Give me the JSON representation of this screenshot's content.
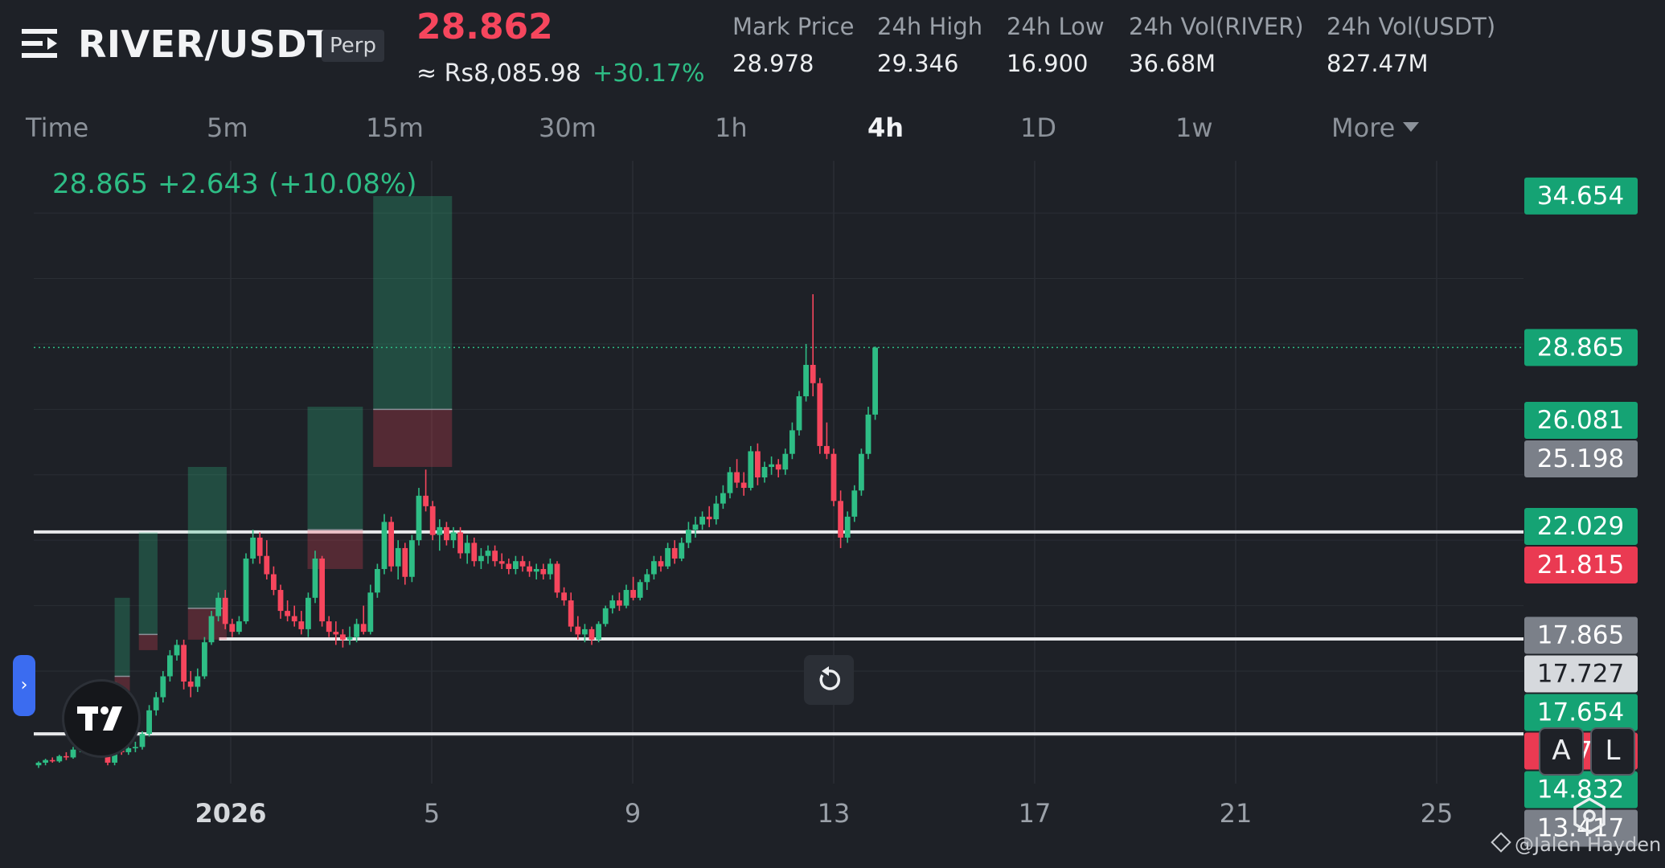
{
  "header": {
    "pair": "RIVER/USDT",
    "contract_type": "Perp",
    "last_price": "28.862",
    "fiat_price": "≈ Rs8,085.98",
    "change_pct": "+30.17%",
    "stats": [
      {
        "label": "Mark Price",
        "value": "28.978"
      },
      {
        "label": "24h High",
        "value": "29.346"
      },
      {
        "label": "24h Low",
        "value": "16.900"
      },
      {
        "label": "24h Vol(RIVER)",
        "value": "36.68M"
      },
      {
        "label": "24h Vol(USDT)",
        "value": "827.47M"
      }
    ]
  },
  "intervals": {
    "tabs": [
      "Time",
      "5m",
      "15m",
      "30m",
      "1h",
      "4h",
      "1D",
      "1w",
      "More"
    ],
    "active": "4h"
  },
  "readout": {
    "close": "28.865",
    "change": "+2.643",
    "change_pct": "(+10.08%)"
  },
  "controls": {
    "scale_auto": "A",
    "scale_log": "L",
    "sidebar_arrow": "›"
  },
  "watermark": "@Jalen Hayden",
  "colors": {
    "up": "#2ebd85",
    "down": "#f6465d",
    "gray_label": "#8a8f98",
    "light_label": "#d5d8dc",
    "background": "#1e2127"
  },
  "chart_data": {
    "type": "candlestick",
    "symbol": "RIVER/USDT",
    "interval": "4h",
    "x_tick_labels": [
      "2026",
      "5",
      "9",
      "13",
      "17",
      "21",
      "25"
    ],
    "ylim": [
      12.2,
      36.0
    ],
    "last_price": 28.865,
    "price_labels": [
      {
        "value": 34.654,
        "style": "up"
      },
      {
        "value": 28.865,
        "style": "up"
      },
      {
        "value": 26.081,
        "style": "up"
      },
      {
        "value": 25.198,
        "style": "gray"
      },
      {
        "value": 22.029,
        "style": "up"
      },
      {
        "value": 21.815,
        "style": "down"
      },
      {
        "value": 17.865,
        "style": "gray"
      },
      {
        "value": 17.727,
        "style": "light"
      },
      {
        "value": 17.654,
        "style": "up"
      },
      {
        "value": 15.716,
        "style": "down"
      },
      {
        "value": 14.832,
        "style": "up"
      },
      {
        "value": 13.417,
        "style": "gray"
      }
    ],
    "horizontal_lines": [
      {
        "value": 21.815,
        "from": 0.0
      },
      {
        "value": 17.727,
        "from": 7.5
      },
      {
        "value": 14.1,
        "from": 0.0
      }
    ],
    "positions": [
      {
        "x0": 7.8,
        "x1": 11.3,
        "entry": 14.4,
        "target": 16.1,
        "stop": 13.75
      },
      {
        "x0": 11.0,
        "x1": 13.2,
        "entry": 16.3,
        "target": 19.3,
        "stop": 15.6
      },
      {
        "x0": 14.5,
        "x1": 17.2,
        "entry": 17.9,
        "target": 21.8,
        "stop": 17.3
      },
      {
        "x0": 21.6,
        "x1": 27.2,
        "entry": 18.9,
        "target": 24.3,
        "stop": 17.7
      },
      {
        "x0": 38.9,
        "x1": 46.9,
        "entry": 21.9,
        "target": 26.6,
        "stop": 20.4
      },
      {
        "x0": 48.4,
        "x1": 59.8,
        "entry": 26.5,
        "target": 34.65,
        "stop": 24.3
      }
    ],
    "candles": [
      {
        "o": 12.9,
        "h": 13.05,
        "l": 12.8,
        "c": 13.0
      },
      {
        "o": 13.0,
        "h": 13.15,
        "l": 12.9,
        "c": 13.1
      },
      {
        "o": 13.1,
        "h": 13.2,
        "l": 13.0,
        "c": 13.05
      },
      {
        "o": 13.05,
        "h": 13.3,
        "l": 13.0,
        "c": 13.25
      },
      {
        "o": 13.25,
        "h": 13.4,
        "l": 13.1,
        "c": 13.2
      },
      {
        "o": 13.2,
        "h": 13.6,
        "l": 13.15,
        "c": 13.5
      },
      {
        "o": 13.5,
        "h": 13.9,
        "l": 13.4,
        "c": 13.8
      },
      {
        "o": 13.8,
        "h": 14.0,
        "l": 13.6,
        "c": 13.7
      },
      {
        "o": 13.7,
        "h": 13.8,
        "l": 13.4,
        "c": 13.5
      },
      {
        "o": 13.5,
        "h": 13.7,
        "l": 13.3,
        "c": 13.4
      },
      {
        "o": 13.4,
        "h": 13.5,
        "l": 12.9,
        "c": 13.0
      },
      {
        "o": 13.0,
        "h": 13.6,
        "l": 12.9,
        "c": 13.5
      },
      {
        "o": 13.5,
        "h": 13.6,
        "l": 13.3,
        "c": 13.4
      },
      {
        "o": 13.4,
        "h": 13.6,
        "l": 13.3,
        "c": 13.55
      },
      {
        "o": 13.55,
        "h": 13.8,
        "l": 13.4,
        "c": 13.6
      },
      {
        "o": 13.6,
        "h": 14.2,
        "l": 13.5,
        "c": 14.1
      },
      {
        "o": 14.1,
        "h": 15.2,
        "l": 14.0,
        "c": 15.0
      },
      {
        "o": 15.0,
        "h": 15.7,
        "l": 14.8,
        "c": 15.5
      },
      {
        "o": 15.5,
        "h": 16.5,
        "l": 15.3,
        "c": 16.3
      },
      {
        "o": 16.3,
        "h": 17.3,
        "l": 16.1,
        "c": 17.1
      },
      {
        "o": 17.1,
        "h": 17.7,
        "l": 16.9,
        "c": 17.5
      },
      {
        "o": 17.5,
        "h": 17.7,
        "l": 15.8,
        "c": 16.1
      },
      {
        "o": 16.1,
        "h": 16.5,
        "l": 15.5,
        "c": 15.9
      },
      {
        "o": 15.9,
        "h": 16.6,
        "l": 15.7,
        "c": 16.3
      },
      {
        "o": 16.3,
        "h": 17.8,
        "l": 16.2,
        "c": 17.6
      },
      {
        "o": 17.6,
        "h": 18.8,
        "l": 17.5,
        "c": 18.6
      },
      {
        "o": 18.6,
        "h": 19.5,
        "l": 18.4,
        "c": 19.3
      },
      {
        "o": 19.3,
        "h": 19.6,
        "l": 18.1,
        "c": 18.3
      },
      {
        "o": 18.3,
        "h": 18.5,
        "l": 17.8,
        "c": 18.0
      },
      {
        "o": 18.0,
        "h": 18.6,
        "l": 17.9,
        "c": 18.4
      },
      {
        "o": 18.4,
        "h": 21.0,
        "l": 18.3,
        "c": 20.8
      },
      {
        "o": 20.8,
        "h": 21.9,
        "l": 20.6,
        "c": 21.6
      },
      {
        "o": 21.6,
        "h": 21.8,
        "l": 20.6,
        "c": 20.9
      },
      {
        "o": 20.9,
        "h": 21.5,
        "l": 20.0,
        "c": 20.2
      },
      {
        "o": 20.2,
        "h": 20.5,
        "l": 19.4,
        "c": 19.6
      },
      {
        "o": 19.6,
        "h": 19.8,
        "l": 18.5,
        "c": 18.8
      },
      {
        "o": 18.8,
        "h": 19.2,
        "l": 18.4,
        "c": 18.6
      },
      {
        "o": 18.6,
        "h": 19.0,
        "l": 18.2,
        "c": 18.4
      },
      {
        "o": 18.4,
        "h": 18.8,
        "l": 17.9,
        "c": 18.1
      },
      {
        "o": 18.1,
        "h": 19.5,
        "l": 17.8,
        "c": 19.3
      },
      {
        "o": 19.3,
        "h": 21.1,
        "l": 19.1,
        "c": 20.8
      },
      {
        "o": 20.8,
        "h": 20.9,
        "l": 18.2,
        "c": 18.4
      },
      {
        "o": 18.4,
        "h": 18.6,
        "l": 17.8,
        "c": 18.0
      },
      {
        "o": 18.0,
        "h": 18.4,
        "l": 17.5,
        "c": 17.9
      },
      {
        "o": 17.9,
        "h": 18.1,
        "l": 17.4,
        "c": 17.7
      },
      {
        "o": 17.7,
        "h": 18.2,
        "l": 17.5,
        "c": 17.8
      },
      {
        "o": 17.8,
        "h": 18.5,
        "l": 17.6,
        "c": 18.3
      },
      {
        "o": 18.3,
        "h": 19.0,
        "l": 17.9,
        "c": 18.0
      },
      {
        "o": 18.0,
        "h": 19.8,
        "l": 17.9,
        "c": 19.5
      },
      {
        "o": 19.5,
        "h": 20.6,
        "l": 19.3,
        "c": 20.4
      },
      {
        "o": 20.4,
        "h": 22.5,
        "l": 20.2,
        "c": 22.2
      },
      {
        "o": 22.2,
        "h": 22.4,
        "l": 20.3,
        "c": 20.5
      },
      {
        "o": 20.5,
        "h": 21.5,
        "l": 20.0,
        "c": 21.2
      },
      {
        "o": 21.2,
        "h": 21.4,
        "l": 19.8,
        "c": 20.1
      },
      {
        "o": 20.1,
        "h": 21.7,
        "l": 19.9,
        "c": 21.5
      },
      {
        "o": 21.5,
        "h": 23.5,
        "l": 21.3,
        "c": 23.2
      },
      {
        "o": 23.2,
        "h": 24.2,
        "l": 22.6,
        "c": 22.8
      },
      {
        "o": 22.8,
        "h": 23.0,
        "l": 21.5,
        "c": 21.7
      },
      {
        "o": 21.7,
        "h": 22.3,
        "l": 21.1,
        "c": 22.0
      },
      {
        "o": 22.0,
        "h": 22.2,
        "l": 21.3,
        "c": 21.5
      },
      {
        "o": 21.5,
        "h": 22.0,
        "l": 21.2,
        "c": 21.8
      },
      {
        "o": 21.8,
        "h": 22.0,
        "l": 20.8,
        "c": 21.0
      },
      {
        "o": 21.0,
        "h": 21.7,
        "l": 20.6,
        "c": 21.4
      },
      {
        "o": 21.4,
        "h": 21.6,
        "l": 20.5,
        "c": 20.7
      },
      {
        "o": 20.7,
        "h": 21.2,
        "l": 20.4,
        "c": 20.9
      },
      {
        "o": 20.9,
        "h": 21.3,
        "l": 20.6,
        "c": 21.1
      },
      {
        "o": 21.1,
        "h": 21.3,
        "l": 20.5,
        "c": 20.7
      },
      {
        "o": 20.7,
        "h": 21.0,
        "l": 20.4,
        "c": 20.6
      },
      {
        "o": 20.6,
        "h": 20.8,
        "l": 20.2,
        "c": 20.4
      },
      {
        "o": 20.4,
        "h": 20.9,
        "l": 20.2,
        "c": 20.7
      },
      {
        "o": 20.7,
        "h": 20.9,
        "l": 20.3,
        "c": 20.5
      },
      {
        "o": 20.5,
        "h": 20.7,
        "l": 20.1,
        "c": 20.3
      },
      {
        "o": 20.3,
        "h": 20.6,
        "l": 20.0,
        "c": 20.4
      },
      {
        "o": 20.4,
        "h": 20.6,
        "l": 20.0,
        "c": 20.2
      },
      {
        "o": 20.2,
        "h": 20.8,
        "l": 20.0,
        "c": 20.6
      },
      {
        "o": 20.6,
        "h": 20.7,
        "l": 19.3,
        "c": 19.5
      },
      {
        "o": 19.5,
        "h": 19.7,
        "l": 19.0,
        "c": 19.2
      },
      {
        "o": 19.2,
        "h": 19.5,
        "l": 18.0,
        "c": 18.2
      },
      {
        "o": 18.2,
        "h": 18.6,
        "l": 17.7,
        "c": 17.9
      },
      {
        "o": 17.9,
        "h": 18.3,
        "l": 17.6,
        "c": 18.1
      },
      {
        "o": 18.1,
        "h": 18.2,
        "l": 17.5,
        "c": 17.7
      },
      {
        "o": 17.7,
        "h": 18.4,
        "l": 17.6,
        "c": 18.3
      },
      {
        "o": 18.3,
        "h": 19.0,
        "l": 18.2,
        "c": 18.9
      },
      {
        "o": 18.9,
        "h": 19.4,
        "l": 18.7,
        "c": 19.2
      },
      {
        "o": 19.2,
        "h": 19.5,
        "l": 18.8,
        "c": 19.0
      },
      {
        "o": 19.0,
        "h": 19.8,
        "l": 18.9,
        "c": 19.6
      },
      {
        "o": 19.6,
        "h": 20.1,
        "l": 19.2,
        "c": 19.3
      },
      {
        "o": 19.3,
        "h": 20.0,
        "l": 19.2,
        "c": 19.9
      },
      {
        "o": 19.9,
        "h": 20.4,
        "l": 19.6,
        "c": 20.2
      },
      {
        "o": 20.2,
        "h": 20.9,
        "l": 20.0,
        "c": 20.7
      },
      {
        "o": 20.7,
        "h": 20.9,
        "l": 20.3,
        "c": 20.5
      },
      {
        "o": 20.5,
        "h": 21.4,
        "l": 20.4,
        "c": 21.2
      },
      {
        "o": 21.2,
        "h": 21.5,
        "l": 20.6,
        "c": 20.8
      },
      {
        "o": 20.8,
        "h": 21.6,
        "l": 20.7,
        "c": 21.4
      },
      {
        "o": 21.4,
        "h": 22.2,
        "l": 21.2,
        "c": 21.9
      },
      {
        "o": 21.9,
        "h": 22.4,
        "l": 21.6,
        "c": 22.1
      },
      {
        "o": 22.1,
        "h": 22.6,
        "l": 21.9,
        "c": 22.4
      },
      {
        "o": 22.4,
        "h": 22.8,
        "l": 22.0,
        "c": 22.3
      },
      {
        "o": 22.3,
        "h": 23.2,
        "l": 22.1,
        "c": 22.9
      },
      {
        "o": 22.9,
        "h": 23.6,
        "l": 22.7,
        "c": 23.3
      },
      {
        "o": 23.3,
        "h": 24.3,
        "l": 23.1,
        "c": 24.1
      },
      {
        "o": 24.1,
        "h": 24.6,
        "l": 23.5,
        "c": 23.7
      },
      {
        "o": 23.7,
        "h": 24.1,
        "l": 23.2,
        "c": 23.5
      },
      {
        "o": 23.5,
        "h": 25.1,
        "l": 23.4,
        "c": 24.9
      },
      {
        "o": 24.9,
        "h": 25.2,
        "l": 23.6,
        "c": 23.9
      },
      {
        "o": 23.9,
        "h": 24.5,
        "l": 23.7,
        "c": 24.3
      },
      {
        "o": 24.3,
        "h": 24.7,
        "l": 24.0,
        "c": 24.4
      },
      {
        "o": 24.4,
        "h": 24.6,
        "l": 23.9,
        "c": 24.2
      },
      {
        "o": 24.2,
        "h": 25.0,
        "l": 24.0,
        "c": 24.8
      },
      {
        "o": 24.8,
        "h": 26.0,
        "l": 24.6,
        "c": 25.7
      },
      {
        "o": 25.7,
        "h": 27.2,
        "l": 25.5,
        "c": 27.0
      },
      {
        "o": 27.0,
        "h": 29.0,
        "l": 26.8,
        "c": 28.2
      },
      {
        "o": 28.2,
        "h": 30.9,
        "l": 27.0,
        "c": 27.5
      },
      {
        "o": 27.5,
        "h": 27.7,
        "l": 24.8,
        "c": 25.1
      },
      {
        "o": 25.1,
        "h": 26.0,
        "l": 24.6,
        "c": 24.8
      },
      {
        "o": 24.8,
        "h": 25.0,
        "l": 22.8,
        "c": 23.0
      },
      {
        "o": 23.0,
        "h": 23.4,
        "l": 21.2,
        "c": 21.6
      },
      {
        "o": 21.6,
        "h": 22.6,
        "l": 21.4,
        "c": 22.4
      },
      {
        "o": 22.4,
        "h": 23.6,
        "l": 22.2,
        "c": 23.4
      },
      {
        "o": 23.4,
        "h": 25.0,
        "l": 23.2,
        "c": 24.8
      },
      {
        "o": 24.8,
        "h": 26.6,
        "l": 24.6,
        "c": 26.3
      },
      {
        "o": 26.3,
        "h": 28.9,
        "l": 26.1,
        "c": 28.86
      }
    ]
  }
}
